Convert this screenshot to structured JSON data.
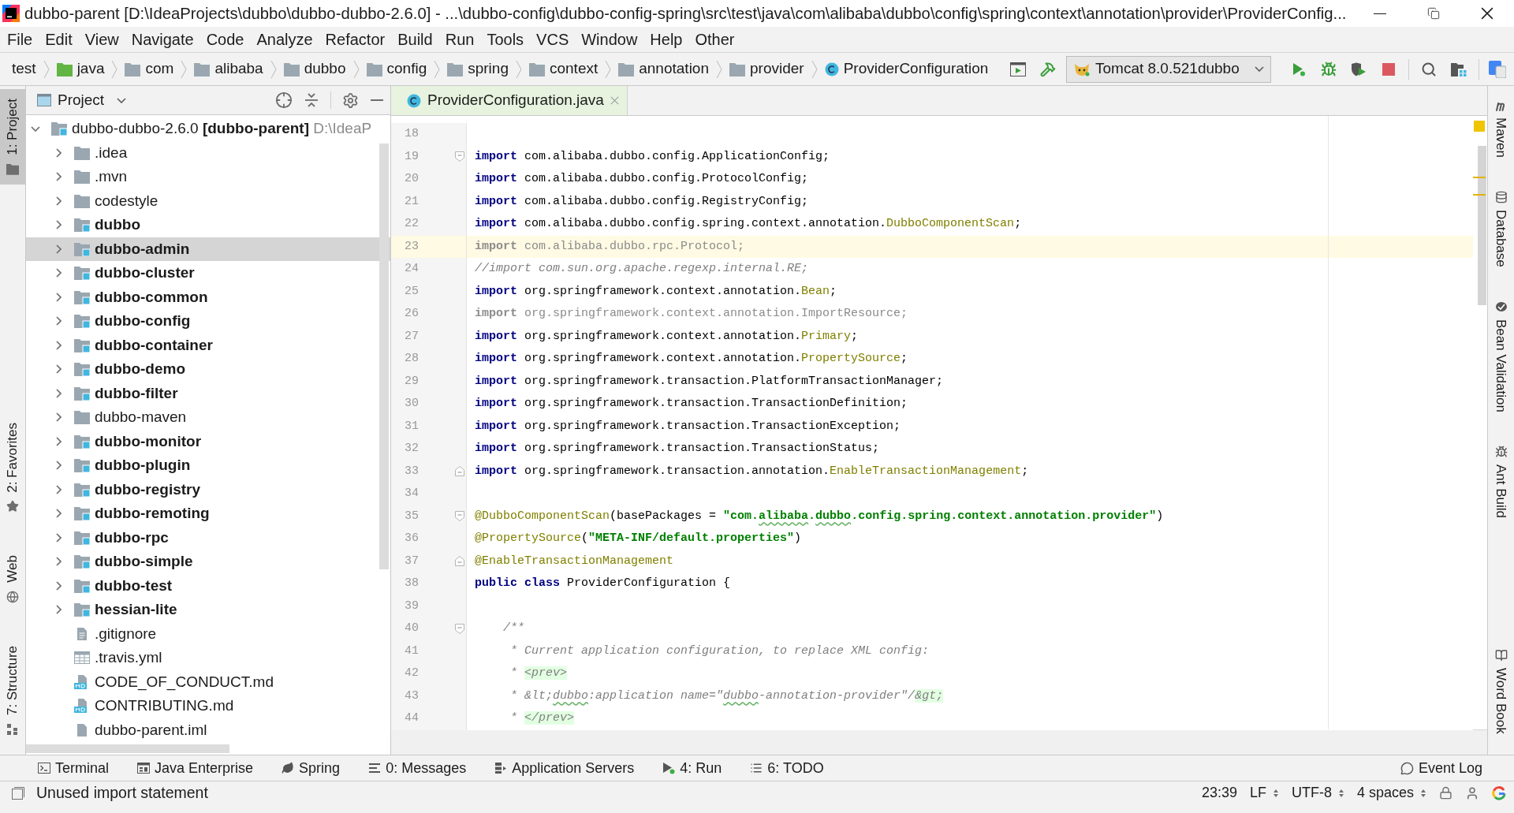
{
  "window": {
    "title": "dubbo-parent [D:\\IdeaProjects\\dubbo\\dubbo-dubbo-2.6.0] - ...\\dubbo-config\\dubbo-config-spring\\src\\test\\java\\com\\alibaba\\dubbo\\config\\spring\\context\\annotation\\provider\\ProviderConfig..."
  },
  "menu": [
    {
      "label": "File"
    },
    {
      "label": "Edit"
    },
    {
      "label": "View"
    },
    {
      "label": "Navigate"
    },
    {
      "label": "Code"
    },
    {
      "label": "Analyze"
    },
    {
      "label": "Refactor"
    },
    {
      "label": "Build"
    },
    {
      "label": "Run"
    },
    {
      "label": "Tools"
    },
    {
      "label": "VCS"
    },
    {
      "label": "Window"
    },
    {
      "label": "Help"
    },
    {
      "label": "Other"
    }
  ],
  "breadcrumb": [
    {
      "label": "test",
      "kind": "plain"
    },
    {
      "label": "java",
      "kind": "source-folder"
    },
    {
      "label": "com",
      "kind": "folder"
    },
    {
      "label": "alibaba",
      "kind": "folder"
    },
    {
      "label": "dubbo",
      "kind": "folder"
    },
    {
      "label": "config",
      "kind": "folder"
    },
    {
      "label": "spring",
      "kind": "folder"
    },
    {
      "label": "context",
      "kind": "folder"
    },
    {
      "label": "annotation",
      "kind": "folder"
    },
    {
      "label": "provider",
      "kind": "folder"
    },
    {
      "label": "ProviderConfiguration",
      "kind": "class"
    }
  ],
  "toolbar": {
    "run_configuration": "Tomcat 8.0.521dubbo"
  },
  "left_tool_tabs": {
    "top": [
      {
        "label": "1: Project",
        "kind": "project",
        "selected": true
      }
    ],
    "bottom": [
      {
        "label": "2: Favorites",
        "kind": "favorites",
        "selected": false
      },
      {
        "label": "Web",
        "kind": "web",
        "selected": false
      },
      {
        "label": "7: Structure",
        "kind": "structure",
        "selected": false
      }
    ]
  },
  "project_panel": {
    "title": "Project",
    "tree": [
      {
        "name": "dubbo-dubbo-2.6.0",
        "module": "[dubbo-parent]",
        "path": "D:\\IdeaP",
        "kind": "project",
        "expanded": true,
        "selected": false,
        "children": [
          {
            "name": ".idea",
            "kind": "folder",
            "expanded": false,
            "selected": false
          },
          {
            "name": ".mvn",
            "kind": "folder",
            "expanded": false,
            "selected": false
          },
          {
            "name": "codestyle",
            "kind": "folder",
            "expanded": false,
            "selected": false
          },
          {
            "name": "dubbo",
            "kind": "module",
            "expanded": false,
            "selected": false
          },
          {
            "name": "dubbo-admin",
            "kind": "module",
            "expanded": false,
            "selected": true
          },
          {
            "name": "dubbo-cluster",
            "kind": "module",
            "expanded": false,
            "selected": false
          },
          {
            "name": "dubbo-common",
            "kind": "module",
            "expanded": false,
            "selected": false
          },
          {
            "name": "dubbo-config",
            "kind": "module",
            "expanded": false,
            "selected": false
          },
          {
            "name": "dubbo-container",
            "kind": "module",
            "expanded": false,
            "selected": false
          },
          {
            "name": "dubbo-demo",
            "kind": "module",
            "expanded": false,
            "selected": false
          },
          {
            "name": "dubbo-filter",
            "kind": "module",
            "expanded": false,
            "selected": false
          },
          {
            "name": "dubbo-maven",
            "kind": "folder",
            "expanded": false,
            "selected": false
          },
          {
            "name": "dubbo-monitor",
            "kind": "module",
            "expanded": false,
            "selected": false
          },
          {
            "name": "dubbo-plugin",
            "kind": "module",
            "expanded": false,
            "selected": false
          },
          {
            "name": "dubbo-registry",
            "kind": "module",
            "expanded": false,
            "selected": false
          },
          {
            "name": "dubbo-remoting",
            "kind": "module",
            "expanded": false,
            "selected": false
          },
          {
            "name": "dubbo-rpc",
            "kind": "module",
            "expanded": false,
            "selected": false
          },
          {
            "name": "dubbo-simple",
            "kind": "module",
            "expanded": false,
            "selected": false
          },
          {
            "name": "dubbo-test",
            "kind": "module",
            "expanded": false,
            "selected": false
          },
          {
            "name": "hessian-lite",
            "kind": "module",
            "expanded": false,
            "selected": false
          },
          {
            "name": ".gitignore",
            "kind": "text-file",
            "selected": false
          },
          {
            "name": ".travis.yml",
            "kind": "table-file",
            "selected": false
          },
          {
            "name": "CODE_OF_CONDUCT.md",
            "kind": "md-file",
            "selected": false
          },
          {
            "name": "CONTRIBUTING.md",
            "kind": "md-file",
            "selected": false
          },
          {
            "name": "dubbo-parent.iml",
            "kind": "iml-file",
            "selected": false
          }
        ]
      }
    ]
  },
  "editor": {
    "tabs": [
      {
        "label": "ProviderConfiguration.java",
        "selected": true
      }
    ],
    "lines": [
      {
        "number": "18",
        "kind": "plain",
        "current": false
      },
      {
        "number": "19",
        "kind": "fold-start",
        "current": false,
        "tokens": [
          {
            "text": "import",
            "kind": "keyword"
          },
          {
            "text": " com.alibaba.dubbo.config.ApplicationConfig;",
            "kind": "plain"
          }
        ]
      },
      {
        "number": "20",
        "kind": "plain",
        "current": false,
        "tokens": [
          {
            "text": "import",
            "kind": "keyword"
          },
          {
            "text": " com.alibaba.dubbo.config.ProtocolConfig;",
            "kind": "plain"
          }
        ]
      },
      {
        "number": "21",
        "kind": "plain",
        "current": false,
        "tokens": [
          {
            "text": "import",
            "kind": "keyword"
          },
          {
            "text": " com.alibaba.dubbo.config.RegistryConfig;",
            "kind": "plain"
          }
        ]
      },
      {
        "number": "22",
        "kind": "plain",
        "current": false,
        "tokens": [
          {
            "text": "import",
            "kind": "keyword"
          },
          {
            "text": " com.alibaba.dubbo.config.spring.context.annotation.",
            "kind": "plain"
          },
          {
            "text": "DubboComponentScan",
            "kind": "class-ref"
          },
          {
            "text": ";",
            "kind": "plain"
          }
        ]
      },
      {
        "number": "23",
        "kind": "plain",
        "current": true,
        "tokens": [
          {
            "text": "import",
            "kind": "unused-keyword"
          },
          {
            "text": " com.alibaba.dubbo.rpc.Protocol;",
            "kind": "unused"
          }
        ]
      },
      {
        "number": "24",
        "kind": "plain",
        "current": false,
        "tokens": [
          {
            "text": "//import com.sun.org.apache.regexp.internal.RE;",
            "kind": "comment"
          }
        ]
      },
      {
        "number": "25",
        "kind": "plain",
        "current": false,
        "tokens": [
          {
            "text": "import",
            "kind": "keyword"
          },
          {
            "text": " org.springframework.context.annotation.",
            "kind": "plain"
          },
          {
            "text": "Bean",
            "kind": "class-ref"
          },
          {
            "text": ";",
            "kind": "plain"
          }
        ]
      },
      {
        "number": "26",
        "kind": "plain",
        "current": false,
        "tokens": [
          {
            "text": "import",
            "kind": "unused-keyword"
          },
          {
            "text": " org.springframework.context.annotation.ImportResource;",
            "kind": "unused"
          }
        ]
      },
      {
        "number": "27",
        "kind": "plain",
        "current": false,
        "tokens": [
          {
            "text": "import",
            "kind": "keyword"
          },
          {
            "text": " org.springframework.context.annotation.",
            "kind": "plain"
          },
          {
            "text": "Primary",
            "kind": "class-ref"
          },
          {
            "text": ";",
            "kind": "plain"
          }
        ]
      },
      {
        "number": "28",
        "kind": "plain",
        "current": false,
        "tokens": [
          {
            "text": "import",
            "kind": "keyword"
          },
          {
            "text": " org.springframework.context.annotation.",
            "kind": "plain"
          },
          {
            "text": "PropertySource",
            "kind": "class-ref"
          },
          {
            "text": ";",
            "kind": "plain"
          }
        ]
      },
      {
        "number": "29",
        "kind": "plain",
        "current": false,
        "tokens": [
          {
            "text": "import",
            "kind": "keyword"
          },
          {
            "text": " org.springframework.transaction.PlatformTransactionManager;",
            "kind": "plain"
          }
        ]
      },
      {
        "number": "30",
        "kind": "plain",
        "current": false,
        "tokens": [
          {
            "text": "import",
            "kind": "keyword"
          },
          {
            "text": " org.springframework.transaction.TransactionDefinition;",
            "kind": "plain"
          }
        ]
      },
      {
        "number": "31",
        "kind": "plain",
        "current": false,
        "tokens": [
          {
            "text": "import",
            "kind": "keyword"
          },
          {
            "text": " org.springframework.transaction.TransactionException;",
            "kind": "plain"
          }
        ]
      },
      {
        "number": "32",
        "kind": "plain",
        "current": false,
        "tokens": [
          {
            "text": "import",
            "kind": "keyword"
          },
          {
            "text": " org.springframework.transaction.TransactionStatus;",
            "kind": "plain"
          }
        ]
      },
      {
        "number": "33",
        "kind": "fold-end",
        "current": false,
        "tokens": [
          {
            "text": "import",
            "kind": "keyword"
          },
          {
            "text": " org.springframework.transaction.annotation.",
            "kind": "plain"
          },
          {
            "text": "EnableTransactionManagement",
            "kind": "class-ref"
          },
          {
            "text": ";",
            "kind": "plain"
          }
        ]
      },
      {
        "number": "34",
        "kind": "plain",
        "current": false
      },
      {
        "number": "35",
        "kind": "fold-start",
        "current": false,
        "tokens": [
          {
            "text": "@DubboComponentScan",
            "kind": "annotation"
          },
          {
            "text": "(basePackages = ",
            "kind": "plain"
          },
          {
            "text": "\"com.",
            "kind": "string"
          },
          {
            "text": "alibaba",
            "kind": "string",
            "typo": true
          },
          {
            "text": ".",
            "kind": "string"
          },
          {
            "text": "dubbo",
            "kind": "string",
            "typo": true
          },
          {
            "text": ".config.spring.context.annotation.provider\"",
            "kind": "string"
          },
          {
            "text": ")",
            "kind": "plain"
          }
        ]
      },
      {
        "number": "36",
        "kind": "plain",
        "current": false,
        "tokens": [
          {
            "text": "@PropertySource",
            "kind": "annotation"
          },
          {
            "text": "(",
            "kind": "plain"
          },
          {
            "text": "\"META-INF/default.properties\"",
            "kind": "string"
          },
          {
            "text": ")",
            "kind": "plain"
          }
        ]
      },
      {
        "number": "37",
        "kind": "fold-end",
        "current": false,
        "tokens": [
          {
            "text": "@EnableTransactionManagement",
            "kind": "annotation"
          }
        ]
      },
      {
        "number": "38",
        "kind": "plain",
        "current": false,
        "tokens": [
          {
            "text": "public",
            "kind": "keyword"
          },
          {
            "text": " class",
            "kind": "keyword"
          },
          {
            "text": " ProviderConfiguration {",
            "kind": "plain"
          }
        ]
      },
      {
        "number": "39",
        "kind": "plain",
        "current": false
      },
      {
        "number": "40",
        "kind": "fold-start",
        "current": false,
        "tokens": [
          {
            "text": "    /**",
            "kind": "comment"
          }
        ]
      },
      {
        "number": "41",
        "kind": "plain",
        "current": false,
        "tokens": [
          {
            "text": "     * Current application configuration, to replace XML config:",
            "kind": "comment"
          }
        ]
      },
      {
        "number": "42",
        "kind": "plain",
        "current": false,
        "tokens": [
          {
            "text": "     * ",
            "kind": "comment"
          },
          {
            "text": "<prev>",
            "kind": "doc-tag"
          }
        ]
      },
      {
        "number": "43",
        "kind": "plain",
        "current": false,
        "tokens": [
          {
            "text": "     * &lt;",
            "kind": "comment"
          },
          {
            "text": "dubbo",
            "kind": "comment",
            "typo": true
          },
          {
            "text": ":application name=\"",
            "kind": "comment"
          },
          {
            "text": "dubbo",
            "kind": "comment",
            "typo": true
          },
          {
            "text": "-annotation-provider\"/",
            "kind": "comment"
          },
          {
            "text": "&gt;",
            "kind": "doc-tag"
          }
        ]
      },
      {
        "number": "44",
        "kind": "plain",
        "current": false,
        "tokens": [
          {
            "text": "     * ",
            "kind": "comment"
          },
          {
            "text": "</prev>",
            "kind": "doc-tag"
          }
        ]
      }
    ]
  },
  "right_tool_tabs": {
    "top": [
      {
        "label": "Maven",
        "kind": "maven",
        "selected": false
      },
      {
        "label": "Database",
        "kind": "database",
        "selected": false
      },
      {
        "label": "Bean Validation",
        "kind": "bean-validation",
        "selected": false
      },
      {
        "label": "Ant Build",
        "kind": "ant-build",
        "selected": false
      }
    ],
    "bottom": [
      {
        "label": "Word Book",
        "kind": "word-book",
        "selected": false
      }
    ]
  },
  "bottom_tool_tabs": {
    "left": [
      {
        "label": "Terminal",
        "kind": "terminal",
        "selected": false
      },
      {
        "label": "Java Enterprise",
        "kind": "java-enterprise",
        "selected": false
      },
      {
        "label": "Spring",
        "kind": "spring",
        "selected": false
      },
      {
        "label": "0: Messages",
        "kind": "messages",
        "selected": false
      },
      {
        "label": "Application Servers",
        "kind": "app-servers",
        "selected": false
      },
      {
        "label": "4: Run",
        "kind": "run",
        "selected": false
      },
      {
        "label": "6: TODO",
        "kind": "todo",
        "selected": false
      }
    ],
    "right": [
      {
        "label": "Event Log",
        "kind": "event-log",
        "selected": false
      }
    ]
  },
  "status_bar": {
    "message": "Unused import statement",
    "position": "23:39",
    "line_separator": "LF",
    "encoding": "UTF-8",
    "indent": "4 spaces"
  }
}
